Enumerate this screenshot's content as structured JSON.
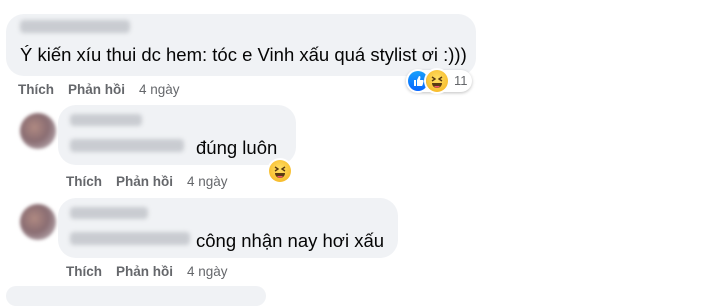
{
  "comments": [
    {
      "text": "Ý kiến xíu thui dc hem: tóc e Vinh xấu quá stylist ơi :)))",
      "like_label": "Thích",
      "reply_label": "Phản hồi",
      "time": "4 ngày",
      "reaction_count": "11"
    },
    {
      "text": "đúng luôn",
      "like_label": "Thích",
      "reply_label": "Phản hồi",
      "time": "4 ngày"
    },
    {
      "text": "công nhận nay hơi xấu",
      "like_label": "Thích",
      "reply_label": "Phản hồi",
      "time": "4 ngày"
    }
  ],
  "icons": {
    "haha": "haha-emoji-icon",
    "like": "like-thumb-icon"
  },
  "colors": {
    "bubble": "#f0f2f5",
    "meta": "#65676b",
    "like_blue": "#0866ff",
    "haha_yellow": "#f7b928"
  }
}
